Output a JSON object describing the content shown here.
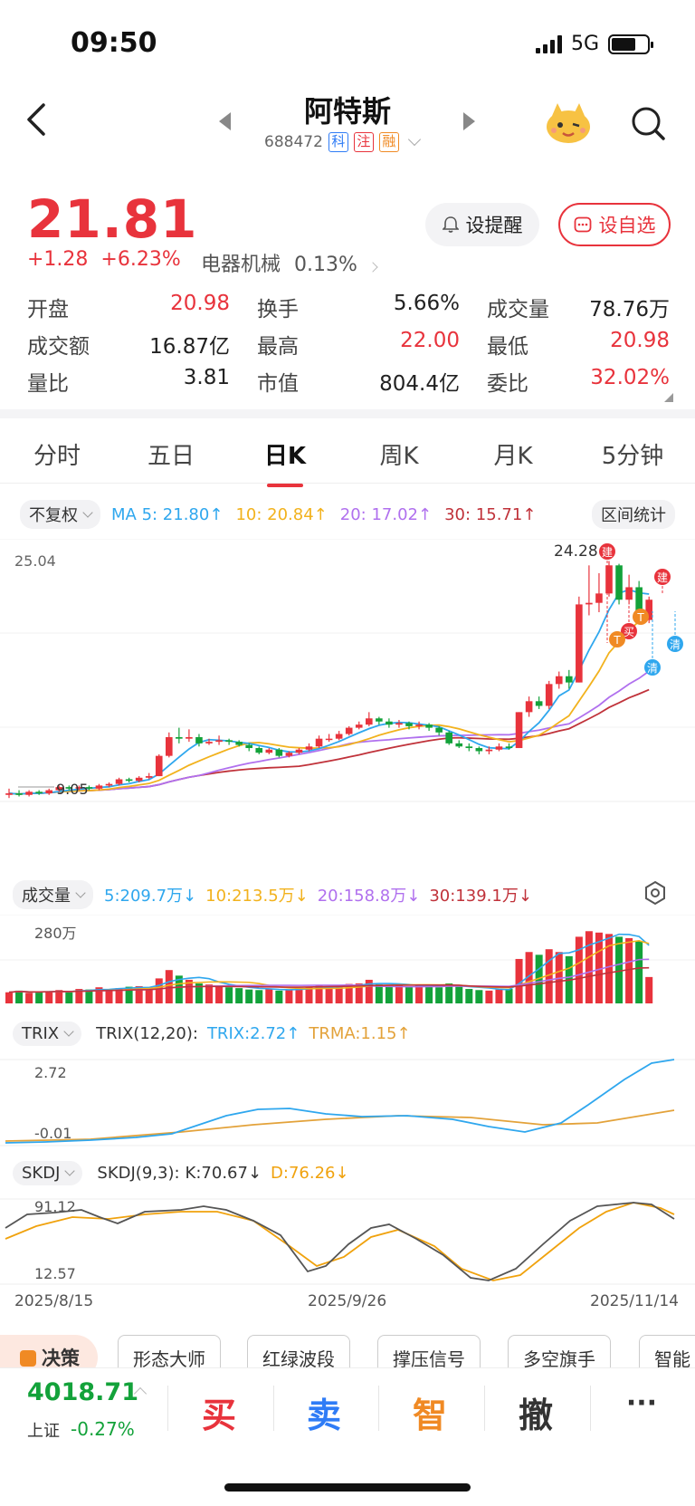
{
  "status_bar": {
    "time": "09:50",
    "network": "5G"
  },
  "header": {
    "stock_name": "阿特斯",
    "stock_code": "688472",
    "tags": [
      {
        "label": "科",
        "color": "#2f7cf6"
      },
      {
        "label": "注",
        "color": "#e8333c"
      },
      {
        "label": "融",
        "color": "#f08a24"
      }
    ]
  },
  "quote": {
    "price": "21.81",
    "change": "+1.28",
    "change_pct": "+6.23%",
    "sector": "电器机械",
    "sector_pct": "0.13%",
    "remind_label": "设提醒",
    "watch_label": "设自选"
  },
  "stats": [
    [
      {
        "label": "开盘",
        "value": "20.98",
        "color": "red"
      },
      {
        "label": "换手",
        "value": "5.66%",
        "color": "dark"
      },
      {
        "label": "成交量",
        "value": "78.76万",
        "color": "dark"
      }
    ],
    [
      {
        "label": "成交额",
        "value": "16.87亿",
        "color": "dark"
      },
      {
        "label": "最高",
        "value": "22.00",
        "color": "red"
      },
      {
        "label": "最低",
        "value": "20.98",
        "color": "red"
      }
    ],
    [
      {
        "label": "量比",
        "value": "3.81",
        "color": "dark"
      },
      {
        "label": "市值",
        "value": "804.4亿",
        "color": "dark"
      },
      {
        "label": "委比",
        "value": "32.02%",
        "color": "red"
      }
    ]
  ],
  "tabs": [
    "分时",
    "五日",
    "日K",
    "周K",
    "月K",
    "5分钟"
  ],
  "active_tab": 2,
  "ma_row": {
    "adjust": "不复权",
    "ma5": "MA 5: 21.80",
    "ma10": "10: 20.84",
    "ma20": "20: 17.02",
    "ma30": "30: 15.71",
    "range_stats": "区间统计",
    "arrow": "↑"
  },
  "kline": {
    "ymax_label": "25.04",
    "high_label": "24.28",
    "low_label": "9.05",
    "marker_build": "建",
    "marker_buy": "买",
    "marker_t": "T",
    "marker_clear": "清"
  },
  "volume_row": {
    "title": "成交量",
    "v5": "5:209.7万",
    "v10": "10:213.5万",
    "v20": "20:158.8万",
    "v30": "30:139.1万",
    "arrow": "↓",
    "ymax_label": "280万"
  },
  "trix_row": {
    "title": "TRIX",
    "params": "TRIX(12,20):",
    "trix": "TRIX:2.72",
    "trma": "TRMA:1.15",
    "arrow": "↑",
    "y_high": "2.72",
    "y_low": "-0.01"
  },
  "skdj_row": {
    "title": "SKDJ",
    "params": "SKDJ(9,3):",
    "k": "K:70.67",
    "d": "D:76.26",
    "arrow": "↓",
    "y_high": "91.12",
    "y_low": "12.57"
  },
  "dates": [
    "2025/8/15",
    "2025/9/26",
    "2025/11/14"
  ],
  "features": [
    "决策",
    "形态大师",
    "红绿波段",
    "撑压信号",
    "多空旗手",
    "智能"
  ],
  "bottom": {
    "index_value": "4018.71",
    "index_name": "上证",
    "index_change": "-0.27%",
    "buy": "买",
    "sell": "卖",
    "smart": "智",
    "cancel": "撤",
    "more": "···"
  },
  "colors": {
    "up": "#e8333c",
    "down": "#13a23a",
    "ma5": "#2fa7ee",
    "ma10": "#f2b21d",
    "ma20": "#b070ee",
    "ma30": "#c0323a",
    "trix": "#2fa7ee",
    "trma": "#e3a23a",
    "k": "#555555",
    "d": "#f0a20d"
  },
  "chart_data": {
    "type": "candlestick",
    "note_series": [
      "MA5",
      "MA10",
      "MA20",
      "MA30"
    ],
    "candles": [
      {
        "o": 9.3,
        "c": 9.4,
        "h": 9.7,
        "l": 9.1
      },
      {
        "o": 9.4,
        "c": 9.3,
        "h": 9.6,
        "l": 9.2
      },
      {
        "o": 9.3,
        "c": 9.5,
        "h": 9.6,
        "l": 9.2
      },
      {
        "o": 9.5,
        "c": 9.4,
        "h": 9.6,
        "l": 9.3
      },
      {
        "o": 9.4,
        "c": 9.6,
        "h": 9.7,
        "l": 9.3
      },
      {
        "o": 9.6,
        "c": 9.8,
        "h": 9.9,
        "l": 9.5
      },
      {
        "o": 9.8,
        "c": 9.7,
        "h": 9.9,
        "l": 9.6
      },
      {
        "o": 9.7,
        "c": 9.8,
        "h": 9.9,
        "l": 9.6
      },
      {
        "o": 9.8,
        "c": 9.7,
        "h": 9.9,
        "l": 9.6
      },
      {
        "o": 9.7,
        "c": 9.9,
        "h": 10.0,
        "l": 9.6
      },
      {
        "o": 9.9,
        "c": 10.0,
        "h": 10.1,
        "l": 9.8
      },
      {
        "o": 10.0,
        "c": 10.3,
        "h": 10.4,
        "l": 9.9
      },
      {
        "o": 10.3,
        "c": 10.2,
        "h": 10.4,
        "l": 10.1
      },
      {
        "o": 10.2,
        "c": 10.4,
        "h": 10.5,
        "l": 10.1
      },
      {
        "o": 10.4,
        "c": 10.5,
        "h": 10.7,
        "l": 10.3
      },
      {
        "o": 10.5,
        "c": 11.8,
        "h": 11.9,
        "l": 10.5
      },
      {
        "o": 11.8,
        "c": 13.0,
        "h": 13.3,
        "l": 11.7
      },
      {
        "o": 13.0,
        "c": 12.9,
        "h": 13.6,
        "l": 12.6
      },
      {
        "o": 12.9,
        "c": 13.0,
        "h": 13.5,
        "l": 12.7
      },
      {
        "o": 13.0,
        "c": 12.6,
        "h": 13.2,
        "l": 12.4
      },
      {
        "o": 12.6,
        "c": 12.7,
        "h": 12.9,
        "l": 12.5
      },
      {
        "o": 12.7,
        "c": 12.8,
        "h": 13.1,
        "l": 12.5
      },
      {
        "o": 12.8,
        "c": 12.7,
        "h": 12.9,
        "l": 12.5
      },
      {
        "o": 12.7,
        "c": 12.5,
        "h": 12.8,
        "l": 12.4
      },
      {
        "o": 12.5,
        "c": 12.3,
        "h": 12.6,
        "l": 12.1
      },
      {
        "o": 12.3,
        "c": 12.0,
        "h": 12.4,
        "l": 11.9
      },
      {
        "o": 12.0,
        "c": 12.2,
        "h": 12.3,
        "l": 11.9
      },
      {
        "o": 12.2,
        "c": 11.8,
        "h": 12.3,
        "l": 11.7
      },
      {
        "o": 11.8,
        "c": 12.0,
        "h": 12.1,
        "l": 11.7
      },
      {
        "o": 12.0,
        "c": 12.2,
        "h": 12.3,
        "l": 11.9
      },
      {
        "o": 12.2,
        "c": 12.4,
        "h": 12.6,
        "l": 12.1
      },
      {
        "o": 12.4,
        "c": 12.9,
        "h": 13.1,
        "l": 12.3
      },
      {
        "o": 12.9,
        "c": 12.9,
        "h": 13.2,
        "l": 12.7
      },
      {
        "o": 12.9,
        "c": 13.2,
        "h": 13.4,
        "l": 12.8
      },
      {
        "o": 13.2,
        "c": 13.6,
        "h": 13.7,
        "l": 13.1
      },
      {
        "o": 13.6,
        "c": 13.8,
        "h": 14.0,
        "l": 13.5
      },
      {
        "o": 13.8,
        "c": 14.2,
        "h": 14.6,
        "l": 13.7
      },
      {
        "o": 14.2,
        "c": 14.0,
        "h": 14.3,
        "l": 13.8
      },
      {
        "o": 14.0,
        "c": 13.8,
        "h": 14.2,
        "l": 13.6
      },
      {
        "o": 13.8,
        "c": 13.9,
        "h": 14.1,
        "l": 13.6
      },
      {
        "o": 13.9,
        "c": 13.7,
        "h": 14.0,
        "l": 13.5
      },
      {
        "o": 13.7,
        "c": 13.8,
        "h": 14.0,
        "l": 13.5
      },
      {
        "o": 13.8,
        "c": 13.6,
        "h": 13.9,
        "l": 13.4
      },
      {
        "o": 13.6,
        "c": 13.3,
        "h": 13.7,
        "l": 13.1
      },
      {
        "o": 13.3,
        "c": 12.6,
        "h": 13.4,
        "l": 12.5
      },
      {
        "o": 12.6,
        "c": 12.4,
        "h": 12.8,
        "l": 12.3
      },
      {
        "o": 12.4,
        "c": 12.3,
        "h": 12.6,
        "l": 12.1
      },
      {
        "o": 12.3,
        "c": 12.1,
        "h": 12.4,
        "l": 11.9
      },
      {
        "o": 12.1,
        "c": 12.2,
        "h": 12.4,
        "l": 11.9
      },
      {
        "o": 12.2,
        "c": 12.4,
        "h": 12.6,
        "l": 12.1
      },
      {
        "o": 12.4,
        "c": 12.3,
        "h": 12.6,
        "l": 12.2
      },
      {
        "o": 12.3,
        "c": 14.6,
        "h": 14.6,
        "l": 12.3
      },
      {
        "o": 14.6,
        "c": 15.3,
        "h": 15.6,
        "l": 14.3
      },
      {
        "o": 15.3,
        "c": 15.0,
        "h": 15.6,
        "l": 14.8
      },
      {
        "o": 15.0,
        "c": 16.4,
        "h": 16.6,
        "l": 14.8
      },
      {
        "o": 16.4,
        "c": 16.9,
        "h": 17.2,
        "l": 16.1
      },
      {
        "o": 16.9,
        "c": 16.5,
        "h": 17.3,
        "l": 16.1
      },
      {
        "o": 16.5,
        "c": 21.5,
        "h": 22.0,
        "l": 16.5
      },
      {
        "o": 21.5,
        "c": 21.6,
        "h": 24.0,
        "l": 20.8
      },
      {
        "o": 21.6,
        "c": 22.2,
        "h": 23.5,
        "l": 21.0
      },
      {
        "o": 22.2,
        "c": 24.0,
        "h": 24.28,
        "l": 22.0
      },
      {
        "o": 24.0,
        "c": 21.8,
        "h": 24.1,
        "l": 21.5
      },
      {
        "o": 21.8,
        "c": 22.6,
        "h": 23.4,
        "l": 21.5
      },
      {
        "o": 22.6,
        "c": 20.6,
        "h": 23.0,
        "l": 20.4
      },
      {
        "o": 20.5,
        "c": 21.8,
        "h": 22.0,
        "l": 20.3
      }
    ]
  }
}
